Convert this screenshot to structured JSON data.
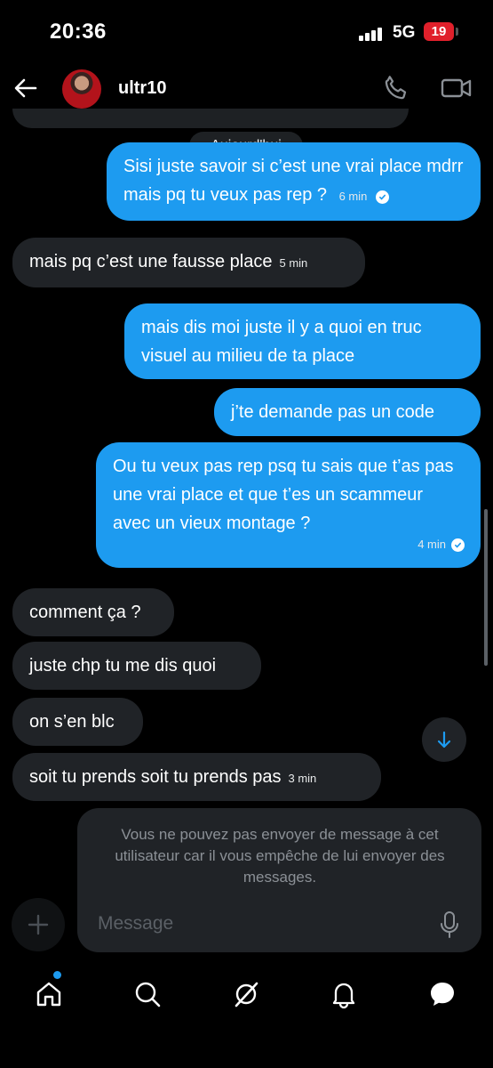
{
  "status_bar": {
    "time": "20:36",
    "network": "5G",
    "battery": "19"
  },
  "header": {
    "username": "ultr10"
  },
  "date_chip": "Aujourd'hui",
  "messages": [
    {
      "direction": "out",
      "text": "Sisi juste savoir si c’est une vrai place mdrr mais pq tu veux pas rep ?",
      "time": "6 min",
      "seen": true
    },
    {
      "direction": "in",
      "text": "mais pq c’est une fausse place",
      "time": "5 min"
    },
    {
      "direction": "out",
      "text": "mais dis moi juste il y a quoi en truc visuel au milieu de ta place"
    },
    {
      "direction": "out",
      "text": "j’te demande pas un code"
    },
    {
      "direction": "out",
      "text": "Ou tu veux pas rep psq tu sais que t’as pas une vrai place et que t’es un scammeur avec un vieux montage ?",
      "time": "4 min",
      "seen": true
    },
    {
      "direction": "in",
      "text": "comment ça ?"
    },
    {
      "direction": "in",
      "text": "juste chp tu me dis quoi"
    },
    {
      "direction": "in",
      "text": "on s’en blc"
    },
    {
      "direction": "in",
      "text": "soit tu prends soit tu prends pas",
      "time": "3 min"
    }
  ],
  "composer": {
    "blocked_notice": "Vous ne pouvez pas envoyer de message à cet utilisateur car il vous empêche de lui envoyer des messages.",
    "placeholder": "Message"
  },
  "icons": {
    "back": "arrow-left-icon",
    "call": "phone-icon",
    "video": "video-camera-icon",
    "scroll": "arrow-down-icon",
    "add": "plus-icon",
    "mic": "microphone-icon",
    "nav": [
      "home-icon",
      "search-icon",
      "grok-icon",
      "bell-icon",
      "messages-icon"
    ]
  },
  "colors": {
    "accent": "#1d9bf0",
    "incoming_bubble": "#202327",
    "battery": "#e0202b",
    "background": "#000000"
  }
}
